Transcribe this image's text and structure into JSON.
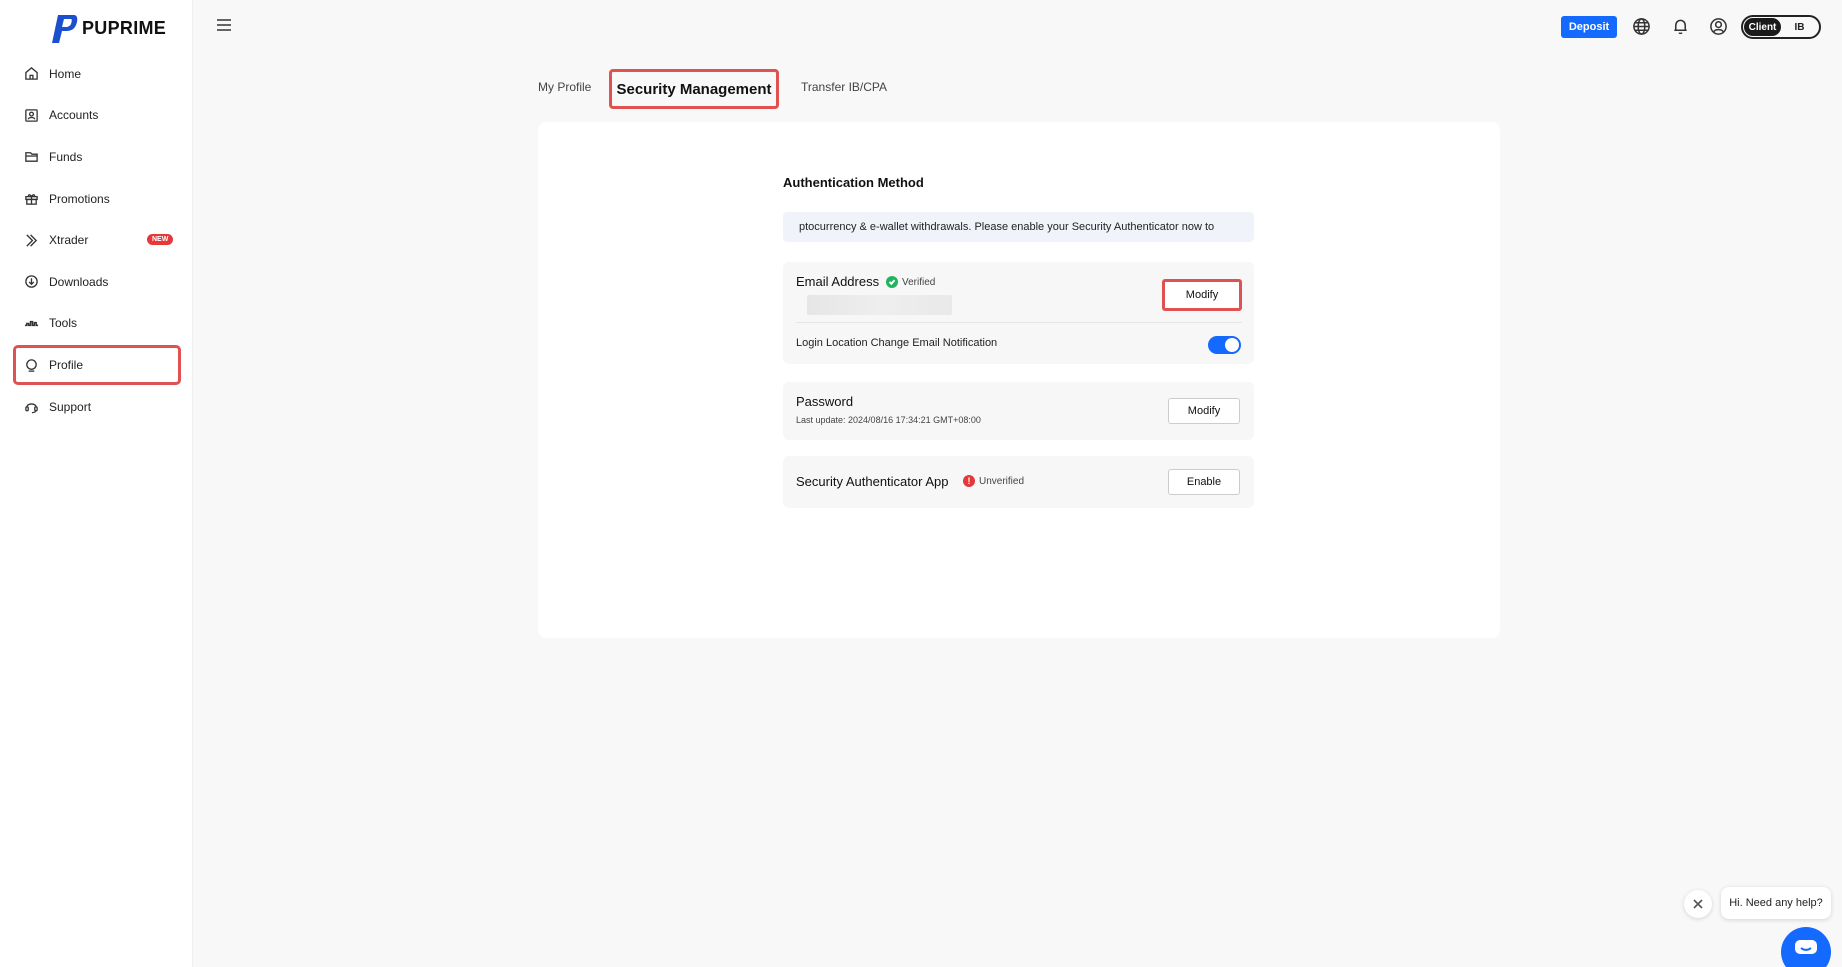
{
  "brand": {
    "name": "PUPRIME"
  },
  "sidebar": {
    "items": [
      {
        "label": "Home",
        "icon": "home-icon"
      },
      {
        "label": "Accounts",
        "icon": "accounts-icon"
      },
      {
        "label": "Funds",
        "icon": "funds-icon"
      },
      {
        "label": "Promotions",
        "icon": "gift-icon"
      },
      {
        "label": "Xtrader",
        "icon": "xtrader-icon",
        "badge": "NEW"
      },
      {
        "label": "Downloads",
        "icon": "download-icon"
      },
      {
        "label": "Tools",
        "icon": "tools-icon"
      },
      {
        "label": "Profile",
        "icon": "profile-icon",
        "selected": true
      },
      {
        "label": "Support",
        "icon": "support-icon"
      }
    ]
  },
  "header": {
    "deposit_label": "Deposit",
    "roles": {
      "client": "Client",
      "ib": "IB",
      "active": "Client"
    }
  },
  "tabs": {
    "my_profile": "My Profile",
    "security": "Security Management",
    "transfer": "Transfer IB/CPA"
  },
  "auth": {
    "title": "Authentication Method",
    "notice": "ptocurrency & e-wallet withdrawals. Please enable your Security Authenticator now to",
    "email": {
      "label": "Email Address",
      "status": "Verified",
      "modify": "Modify",
      "notification_label": "Login Location Change Email Notification",
      "notification_enabled": true
    },
    "password": {
      "label": "Password",
      "last_update": "Last update: 2024/08/16 17:34:21 GMT+08:00",
      "modify": "Modify"
    },
    "authenticator": {
      "label": "Security Authenticator App",
      "status": "Unverified",
      "enable": "Enable"
    }
  },
  "chat": {
    "prompt": "Hi. Need any help?"
  },
  "colors": {
    "accent": "#1469ff",
    "highlight": "#e05252",
    "verified": "#22b35e",
    "unverified": "#e5383b"
  }
}
